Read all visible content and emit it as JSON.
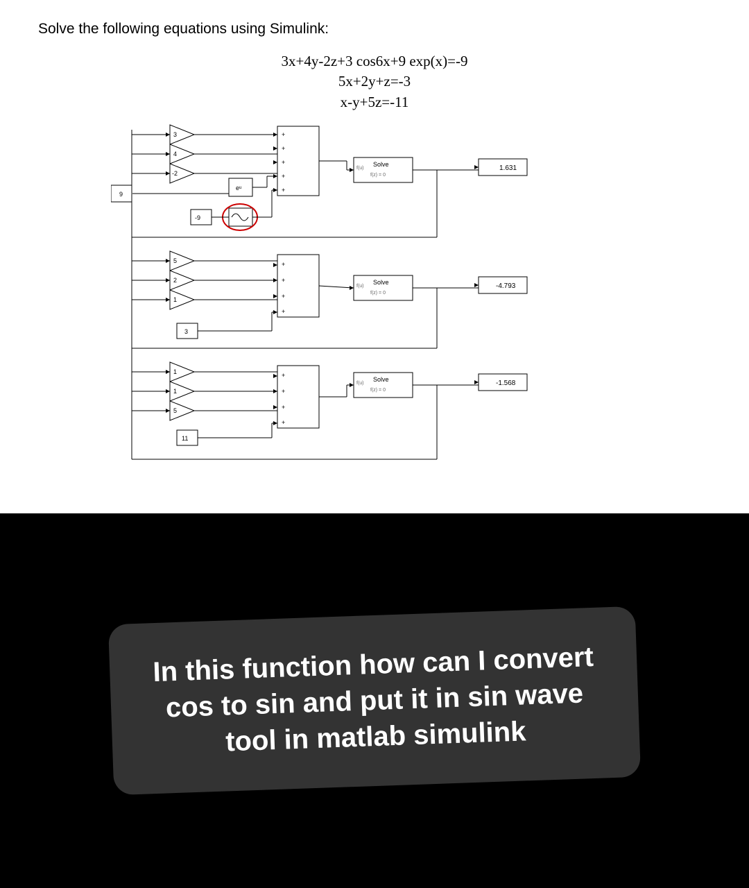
{
  "prompt": "Solve the following equations using Simulink:",
  "equations": {
    "eq1": "3x+4y-2z+3 cos6x+9 exp(x)=-9",
    "eq2": "5x+2y+z=-3",
    "eq3": "x-y+5z=-11"
  },
  "gains": {
    "g1": "3",
    "g2": "4",
    "g3": "-2",
    "g4": "9",
    "g5": "-9",
    "g6": "5",
    "g7": "2",
    "g8": "1",
    "g9": "3",
    "g10": "1",
    "g11": "1",
    "g12": "5",
    "g13": "11"
  },
  "funcblocks": {
    "exp": "eᵘ",
    "cos_icon": "cos-wave-icon"
  },
  "solve": {
    "label_top": "Solve",
    "label_bot": "f(z) = 0",
    "prefix": "f(u)"
  },
  "displays": {
    "d1": "1.631",
    "d2": "-4.793",
    "d3": "-1.568"
  },
  "question": "In this function how can I convert cos to sin and put it in sin wave tool in matlab simulink"
}
